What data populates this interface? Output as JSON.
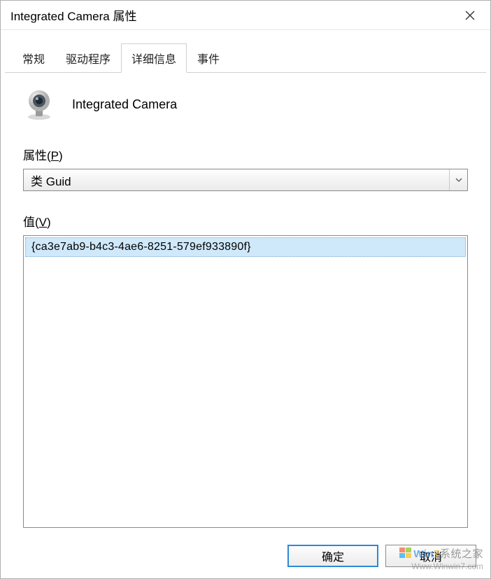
{
  "window": {
    "title": "Integrated Camera 属性"
  },
  "tabs": {
    "items": [
      {
        "label": "常规"
      },
      {
        "label": "驱动程序"
      },
      {
        "label": "详细信息"
      },
      {
        "label": "事件"
      }
    ],
    "active_index": 2
  },
  "device": {
    "name": "Integrated Camera"
  },
  "property": {
    "label_prefix": "属性(",
    "label_key": "P",
    "label_suffix": ")",
    "selected": "类 Guid"
  },
  "value": {
    "label_prefix": "值(",
    "label_key": "V",
    "label_suffix": ")",
    "items": [
      "{ca3e7ab9-b4c3-4ae6-8251-579ef933890f}"
    ]
  },
  "buttons": {
    "ok": "确定",
    "cancel": "取消"
  },
  "watermark": {
    "brand_prefix": "Win",
    "brand_digit": "7",
    "brand_suffix": "系统之家",
    "url": "Www.Winwin7.com"
  }
}
